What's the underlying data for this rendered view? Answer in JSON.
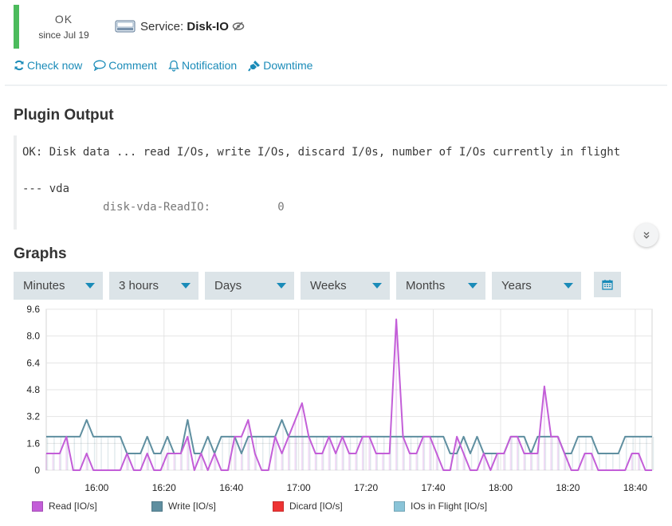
{
  "status": {
    "state": "OK",
    "since": "since Jul 19",
    "color": "#4cbb5c"
  },
  "service": {
    "prefix": "Service:",
    "name": "Disk-IO",
    "icon": "hdd-icon"
  },
  "actions": [
    {
      "label": "Check now",
      "icon": "refresh-icon"
    },
    {
      "label": "Comment",
      "icon": "comment-icon"
    },
    {
      "label": "Notification",
      "icon": "bell-icon"
    },
    {
      "label": "Downtime",
      "icon": "plug-icon"
    }
  ],
  "plugin_output": {
    "title": "Plugin Output",
    "line1": "OK: Disk data ... read I/Os, write I/Os, discard I/0s, number of I/Os currently in flight",
    "line2": "--- vda",
    "line3": "            disk-vda-ReadIO:          0"
  },
  "graphs": {
    "title": "Graphs",
    "ranges": [
      "Minutes",
      "3 hours",
      "Days",
      "Weeks",
      "Months",
      "Years"
    ],
    "calendar_icon": "calendar-icon"
  },
  "chart_data": {
    "type": "line",
    "ylim": [
      0,
      9.6
    ],
    "yticks": [
      "0",
      "1.6",
      "3.2",
      "4.8",
      "6.4",
      "8.0",
      "9.6"
    ],
    "xticks": [
      "16:00",
      "16:20",
      "16:40",
      "17:00",
      "17:20",
      "17:40",
      "18:00",
      "18:20",
      "18:40"
    ],
    "x_start_min": 945,
    "x_end_min": 1125,
    "step_min": 2,
    "grid": true,
    "legend_position": "bottom",
    "series": [
      {
        "name": "Read [IO/s]",
        "color": "#c35ed8",
        "values": [
          1,
          1,
          1,
          2,
          0,
          0,
          1,
          0,
          0,
          0,
          0,
          0,
          1,
          0,
          0,
          1,
          0,
          0,
          1,
          1,
          1,
          2,
          0,
          1,
          0,
          1,
          0,
          0,
          2,
          2,
          3,
          1,
          0,
          0,
          2,
          1,
          2,
          3,
          4,
          2,
          1,
          1,
          2,
          1,
          2,
          1,
          1,
          2,
          2,
          1,
          1,
          1,
          9,
          2,
          1,
          1,
          2,
          2,
          1,
          0,
          0,
          2,
          1,
          0,
          0,
          1,
          0,
          1,
          1,
          2,
          2,
          1,
          1,
          1,
          5,
          2,
          2,
          1,
          0,
          0,
          1,
          1,
          0,
          0,
          0,
          0,
          0,
          1,
          1,
          0,
          0
        ]
      },
      {
        "name": "Write [IO/s]",
        "color": "#5f8fa0",
        "values": [
          2,
          2,
          2,
          2,
          2,
          2,
          3,
          2,
          2,
          2,
          2,
          2,
          1,
          1,
          1,
          2,
          1,
          1,
          2,
          1,
          1,
          3,
          1,
          1,
          2,
          1,
          2,
          2,
          2,
          1,
          2,
          2,
          2,
          2,
          2,
          3,
          2,
          2,
          2,
          2,
          2,
          2,
          2,
          2,
          2,
          2,
          2,
          2,
          2,
          2,
          2,
          2,
          2,
          2,
          2,
          2,
          2,
          2,
          2,
          2,
          1,
          1,
          2,
          1,
          2,
          1,
          1,
          1,
          1,
          2,
          2,
          2,
          1,
          2,
          2,
          2,
          2,
          1,
          1,
          2,
          2,
          2,
          1,
          1,
          1,
          1,
          2,
          2,
          2,
          2,
          2,
          2,
          1,
          1
        ]
      },
      {
        "name": "Dicard [IO/s]",
        "color": "#ee3333",
        "values": []
      },
      {
        "name": "IOs in Flight [IO/s]",
        "color": "#8ac4d8",
        "values": []
      }
    ]
  }
}
